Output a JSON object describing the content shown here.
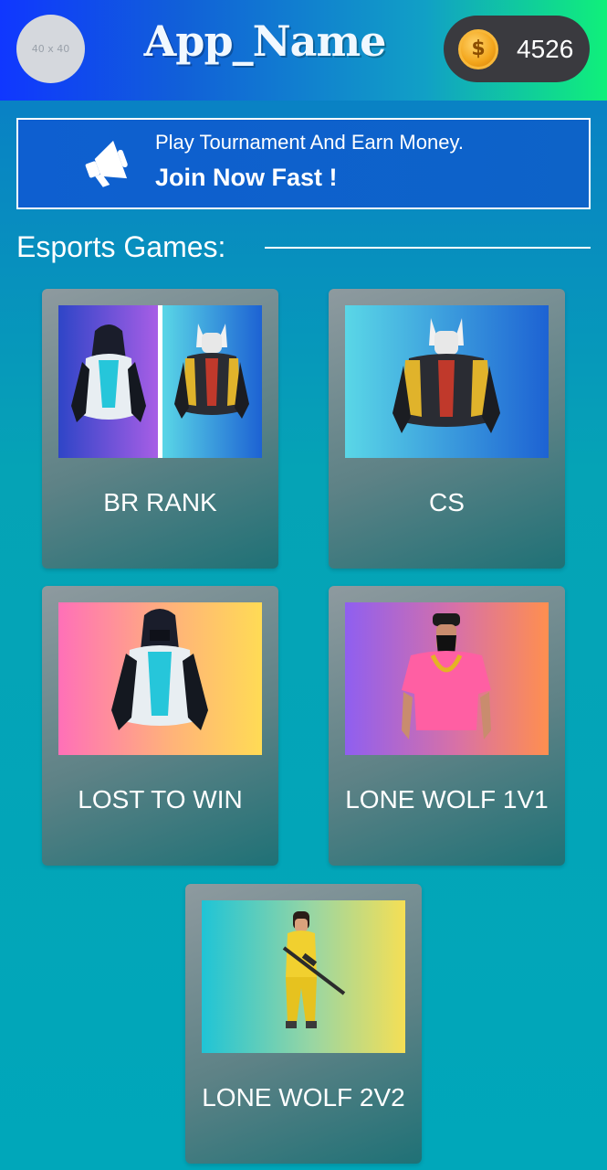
{
  "header": {
    "avatar_placeholder": "40 x 40",
    "app_name": "App_Name",
    "coin_symbol": "$",
    "coin_balance": "4526"
  },
  "banner": {
    "line1": "Play Tournament And Earn Money.",
    "line2": "Join Now Fast !",
    "icon": "megaphone-icon"
  },
  "section": {
    "title": "Esports Games:"
  },
  "games": [
    {
      "label": "BR RANK",
      "image": "two-characters"
    },
    {
      "label": "CS",
      "image": "masked-character"
    },
    {
      "label": "LOST TO WIN",
      "image": "hooded-character"
    },
    {
      "label": "LONE WOLF 1V1",
      "image": "pink-shirt-character"
    },
    {
      "label": "LONE WOLF 2V2",
      "image": "sniper-character"
    }
  ],
  "colors": {
    "header_start": "#1037ff",
    "header_end": "#10f07a",
    "coin_pill": "#3a3a3f",
    "coin": "#f3a51b",
    "banner": "#0e5fd0"
  }
}
